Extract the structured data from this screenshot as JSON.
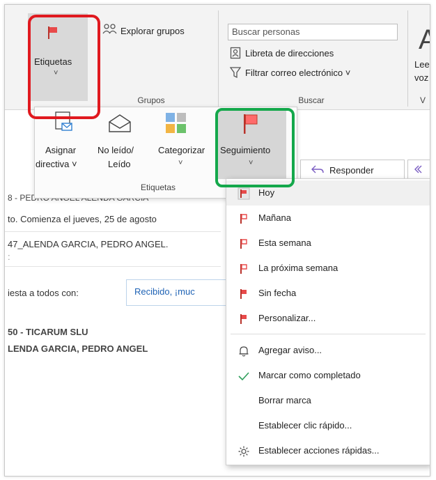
{
  "ribbon": {
    "etiquetas_button": "Etiquetas",
    "explorar_grupos": "Explorar grupos",
    "grupos_label": "Grupos",
    "buscar_personas_placeholder": "Buscar personas",
    "libreta": "Libreta de direcciones",
    "filtrar": "Filtrar correo electrónico ˅",
    "buscar_label": "Buscar",
    "leer_partial": "Lee",
    "voz_partial": "voz",
    "v_partial": "V",
    "big_a": "A"
  },
  "dropdown": {
    "asignar_line1": "Asignar",
    "asignar_line2": "directiva ˅",
    "noleido_line1": "No leído/",
    "noleido_line2": "Leído",
    "categorizar": "Categorizar",
    "categorizar_chevron": "˅",
    "seguimiento": "Seguimiento",
    "seguimiento_chevron": "˅",
    "group_label": "Etiquetas"
  },
  "email": {
    "header_partial": "8 - PEDRO ANGEL ALENDA GARCIA",
    "line_meeting": "to. Comienza el jueves, 25 de agosto",
    "line_attachment": "47_ALENDA GARCIA, PEDRO ANGEL.",
    "respond_prefix": "iesta a todos con:",
    "respond_chip": "Recibido, ¡muc",
    "responder_button": "Responder",
    "sender_line1": "50 - TICARUM SLU",
    "sender_line2": "LENDA GARCIA, PEDRO ANGEL"
  },
  "menu": {
    "items": [
      {
        "label": "Hoy",
        "icon": "flag-icon"
      },
      {
        "label": "Mañana",
        "icon": "flag-icon"
      },
      {
        "label": "Esta semana",
        "icon": "flag-icon"
      },
      {
        "label": "La próxima semana",
        "icon": "flag-icon"
      },
      {
        "label": "Sin fecha",
        "icon": "flag-icon"
      },
      {
        "label": "Personalizar...",
        "icon": "flag-icon"
      },
      {
        "label": "Agregar aviso...",
        "icon": "bell-icon"
      },
      {
        "label": "Marcar como completado",
        "icon": "checkmark-icon"
      },
      {
        "label": "Borrar marca",
        "icon": ""
      },
      {
        "label": "Establecer clic rápido...",
        "icon": ""
      },
      {
        "label": "Establecer acciones rápidas...",
        "icon": "gear-icon"
      }
    ]
  },
  "colors": {
    "flag": "#e74c3c",
    "highlight_red": "#e0191f",
    "highlight_green": "#14a84b",
    "check": "#2e9e5b"
  }
}
